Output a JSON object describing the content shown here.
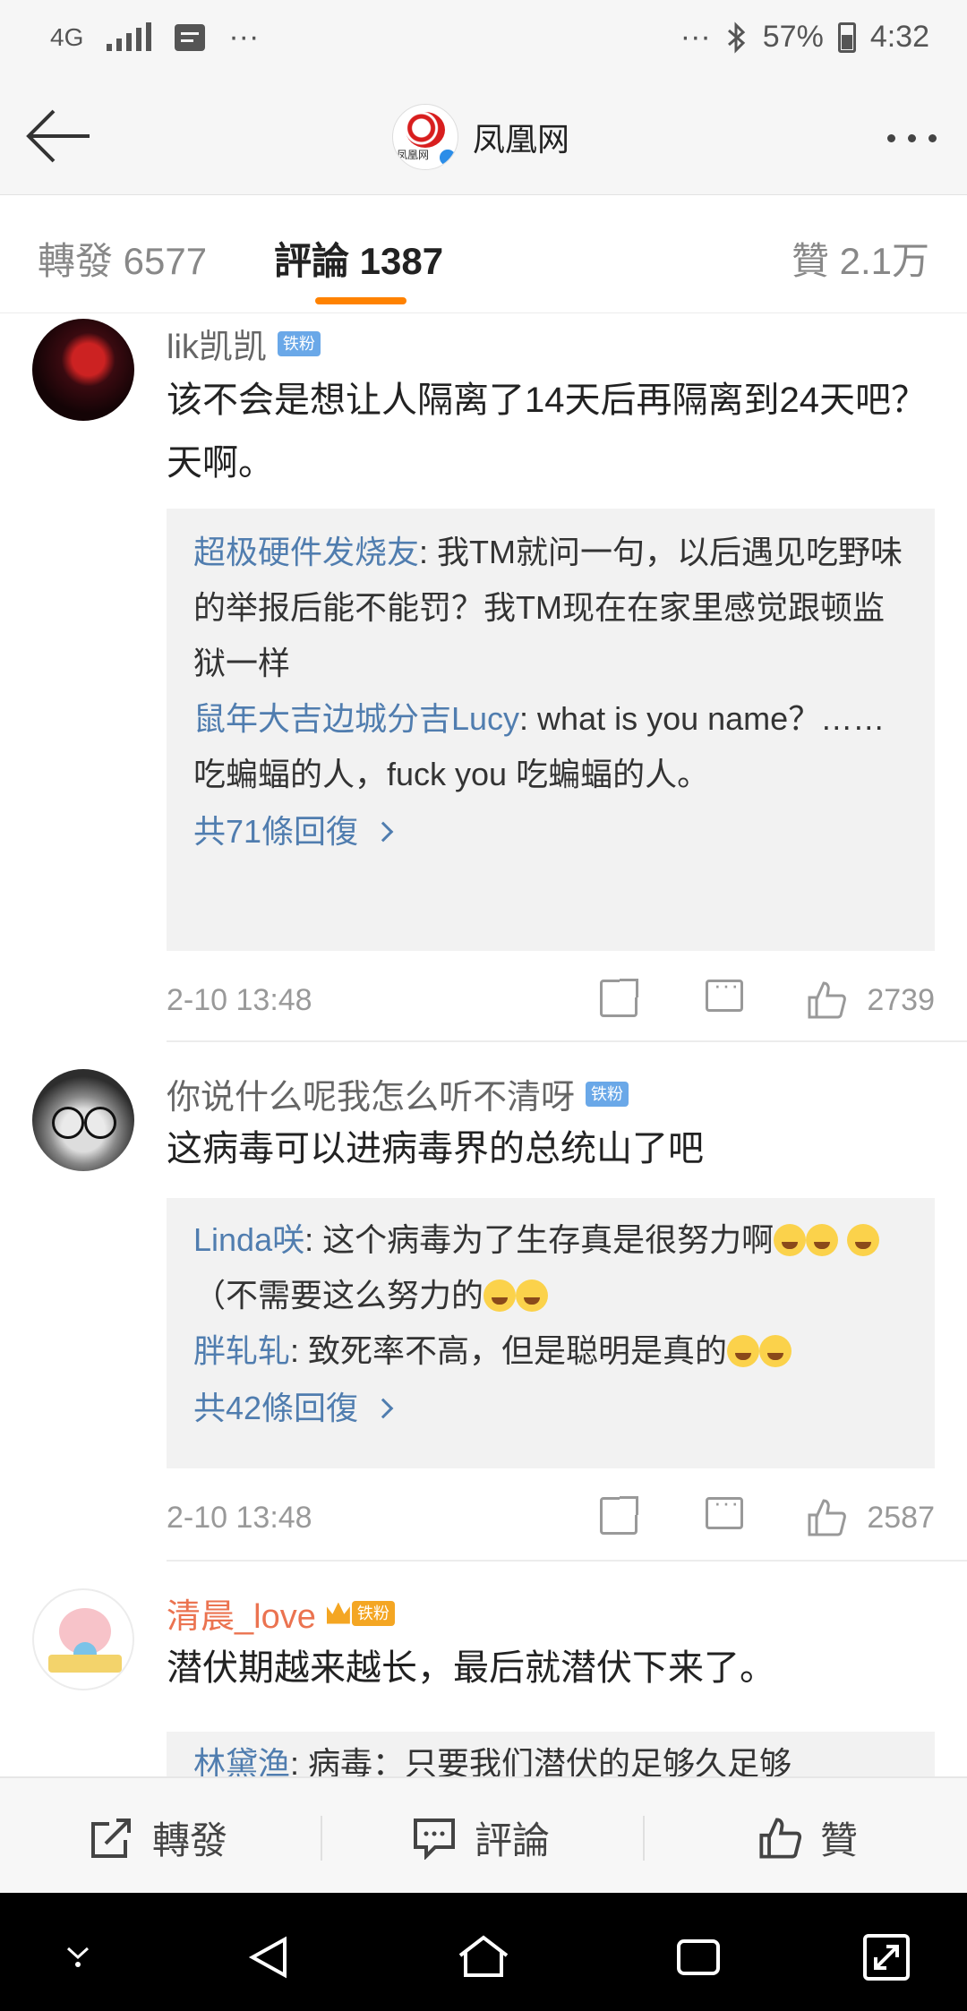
{
  "status_bar": {
    "network": "4G",
    "overflow": "···",
    "overflow_right": "···",
    "battery": "57%",
    "time": "4:32",
    "icons": [
      "signal-icon",
      "message-icon",
      "bluetooth-icon",
      "battery-icon"
    ]
  },
  "nav": {
    "title": "凤凰网",
    "logo_text": "凤凰网",
    "back_icon": "back-arrow-icon",
    "more_icon": "more-dots-icon"
  },
  "tabs": {
    "forward_label": "轉發 6577",
    "comments_label": "評論 1387",
    "likes_label": "贊 2.1万",
    "accent_color": "#ff8200"
  },
  "comments": [
    {
      "username": "lik凯凯",
      "badge": "铁粉",
      "text": "该不会是想让人隔离了14天后再隔离到24天吧？天啊。",
      "replies": [
        {
          "name": "超极硬件发烧友",
          "text": ": 我TM就问一句，以后遇见吃野味的举报后能不能罚？我TM现在在家里感觉跟顿监狱一样"
        },
        {
          "name": "鼠年大吉边城分吉Lucy",
          "text": ": what is you name？…… 吃蝙蝠的人，fuck you 吃蝙蝠的人。"
        }
      ],
      "more_replies": "共71條回復",
      "time": "2-10 13:48",
      "likes": "2739"
    },
    {
      "username": "你说什么呢我怎么听不清呀",
      "badge": "铁粉",
      "text": "这病毒可以进病毒界的总统山了吧",
      "replies": [
        {
          "name": "Linda咲",
          "text": ": 这个病毒为了生存真是很努力啊",
          "text2": "（不需要这么努力的"
        },
        {
          "name": "胖轧轧",
          "text": ": 致死率不高，但是聪明是真的"
        }
      ],
      "more_replies": "共42條回復",
      "time": "2-10 13:48",
      "likes": "2587"
    },
    {
      "username": "清晨_love",
      "badge": "铁粉",
      "text": "潜伏期越来越长，最后就潜伏下来了。",
      "replies": [
        {
          "name": "林黛渔",
          "text": ": 病毒：只要我们潜伏的足够久足够"
        }
      ]
    }
  ],
  "bottom_bar": {
    "forward": "轉發",
    "comment": "評論",
    "like": "贊"
  }
}
